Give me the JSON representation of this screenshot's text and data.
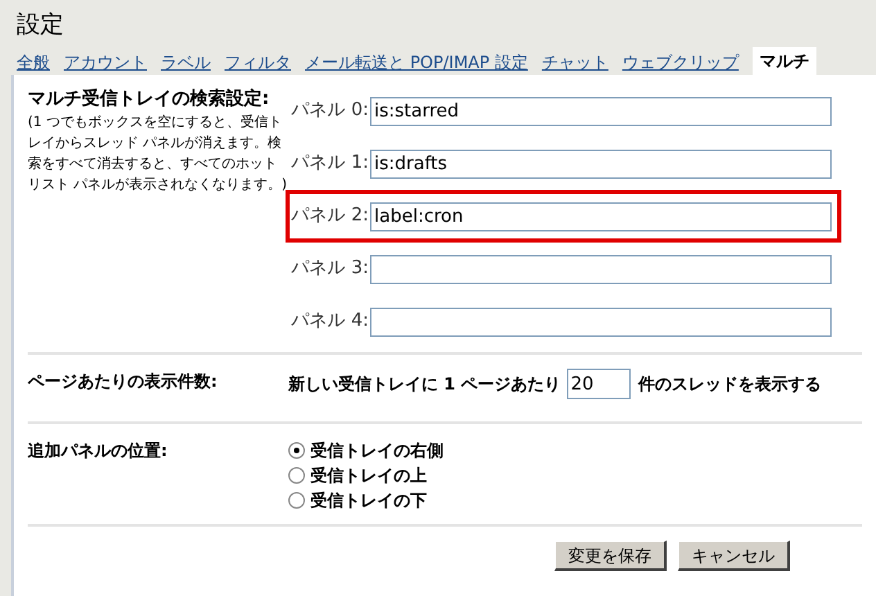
{
  "window": {
    "title": "設定"
  },
  "tabs": [
    {
      "label": "全般",
      "selected": false
    },
    {
      "label": "アカウント",
      "selected": false
    },
    {
      "label": "ラベル",
      "selected": false
    },
    {
      "label": "フィルタ",
      "selected": false
    },
    {
      "label": "メール転送と POP/IMAP 設定",
      "selected": false
    },
    {
      "label": "チャット",
      "selected": false
    },
    {
      "label": "ウェブクリップ",
      "selected": false
    },
    {
      "label": "マルチ",
      "selected": true
    }
  ],
  "search_settings": {
    "title": "マルチ受信トレイの検索設定:",
    "note": "(1 つでもボックスを空にすると、受信トレイからスレッド パネルが消えます。検索をすべて消去すると、すべてのホットリスト パネルが表示されなくなります。)",
    "panels": [
      {
        "label": "パネル 0:",
        "value": "is:starred",
        "highlighted": false
      },
      {
        "label": "パネル 1:",
        "value": "is:drafts",
        "highlighted": false
      },
      {
        "label": "パネル 2:",
        "value": "label:cron",
        "highlighted": true
      },
      {
        "label": "パネル 3:",
        "highlighted": false
      },
      {
        "label": "パネル 4:",
        "highlighted": false
      }
    ]
  },
  "page_size": {
    "title": "ページあたりの表示件数:",
    "before": "新しい受信トレイに 1 ページあたり",
    "value": "20",
    "after": "件のスレッドを表示する"
  },
  "panel_position": {
    "title": "追加パネルの位置:",
    "options": [
      {
        "label": "受信トレイの右側",
        "selected": true
      },
      {
        "label": "受信トレイの上",
        "selected": false
      },
      {
        "label": "受信トレイの下",
        "selected": false
      }
    ]
  },
  "buttons": [
    "変更を保存",
    "キャンセル"
  ]
}
